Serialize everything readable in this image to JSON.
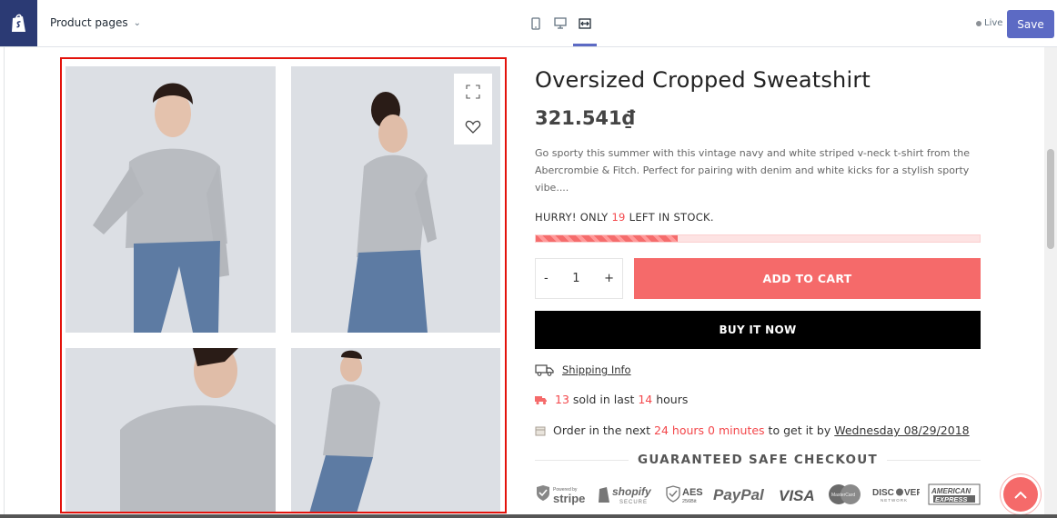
{
  "editor": {
    "page_selector": "Product pages",
    "status": "Live",
    "save_label": "Save"
  },
  "product": {
    "title": "Oversized Cropped Sweatshirt",
    "price": "321.541₫",
    "description": "Go sporty this summer with this vintage navy and white striped v-neck t-shirt from the Abercrombie & Fitch. Perfect for pairing with denim and white kicks for a stylish sporty vibe....",
    "stock": {
      "prefix": "HURRY! ONLY",
      "count": "19",
      "suffix": "LEFT IN STOCK.",
      "level_fraction": 0.32
    },
    "quantity": {
      "minus": "-",
      "value": "1",
      "plus": "+"
    },
    "add_to_cart": "ADD TO CART",
    "buy_now": "BUY IT NOW",
    "shipping_info": "Shipping Info",
    "sold": {
      "count": "13",
      "middle": "sold in last",
      "hours": "14",
      "suffix": "hours"
    },
    "order": {
      "prefix": "Order in the next",
      "time": "24 hours 0 minutes",
      "middle": "to get it by",
      "date": "Wednesday 08/29/2018"
    },
    "guarantee": "GUARANTEED SAFE CHECKOUT",
    "badges": [
      "Powered by stripe",
      "shopify SECURE",
      "AES 256Bit",
      "PayPal",
      "VISA",
      "MasterCard",
      "DISCOVER NETWORK",
      "AMERICAN EXPRESS"
    ]
  },
  "colors": {
    "accent": "#f56a6a",
    "highlight_red": "#f3474b",
    "editor_primary": "#5c6ac4",
    "gallery_outline": "#e3120b"
  }
}
